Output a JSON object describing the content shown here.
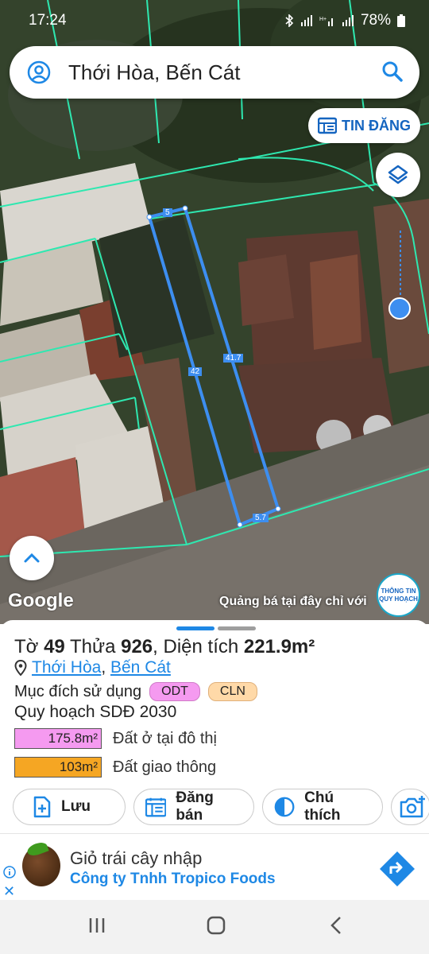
{
  "status": {
    "time": "17:24",
    "battery": "78%"
  },
  "search": {
    "title": "Thới Hòa, Bến Cát"
  },
  "map": {
    "tin_dang_label": "TIN ĐĂNG",
    "google_label": "Google",
    "promo_text": "Quảng bá tại đây chỉ với",
    "badge_line1": "THÔNG TIN",
    "badge_line2": "QUY HOẠCH",
    "edge_labels": [
      "5",
      "42",
      "41.7",
      "5.7"
    ]
  },
  "parcel": {
    "to_label": "Tờ",
    "to_value": "49",
    "thua_label": "Thửa",
    "thua_value": "926",
    "dien_tich_label": ", Diện tích",
    "dien_tich_value": "221.9m²",
    "location_part1": "Thới Hòa",
    "location_sep": ",",
    "location_part2": "Bến Cát",
    "purpose_label": "Mục đích sử dụng",
    "purpose_chips": [
      "ODT",
      "CLN"
    ],
    "plan_label": "Quy hoạch SDĐ 2030",
    "areas": [
      {
        "value": "175.8m²",
        "label": "Đất ở tại đô thị",
        "color": "#f59af0"
      },
      {
        "value": "103m²",
        "label": "Đất giao thông",
        "color": "#f5a623"
      }
    ]
  },
  "actions": {
    "save": "Lưu",
    "post": "Đăng bán",
    "legend": "Chú thích"
  },
  "ad": {
    "headline": "Giỏ trái cây nhập",
    "company": "Công ty Tnhh Tropico Foods"
  },
  "colors": {
    "accent": "#1e88e5",
    "parcel_line": "#3d8ef0",
    "boundary": "#2ee8b0"
  }
}
